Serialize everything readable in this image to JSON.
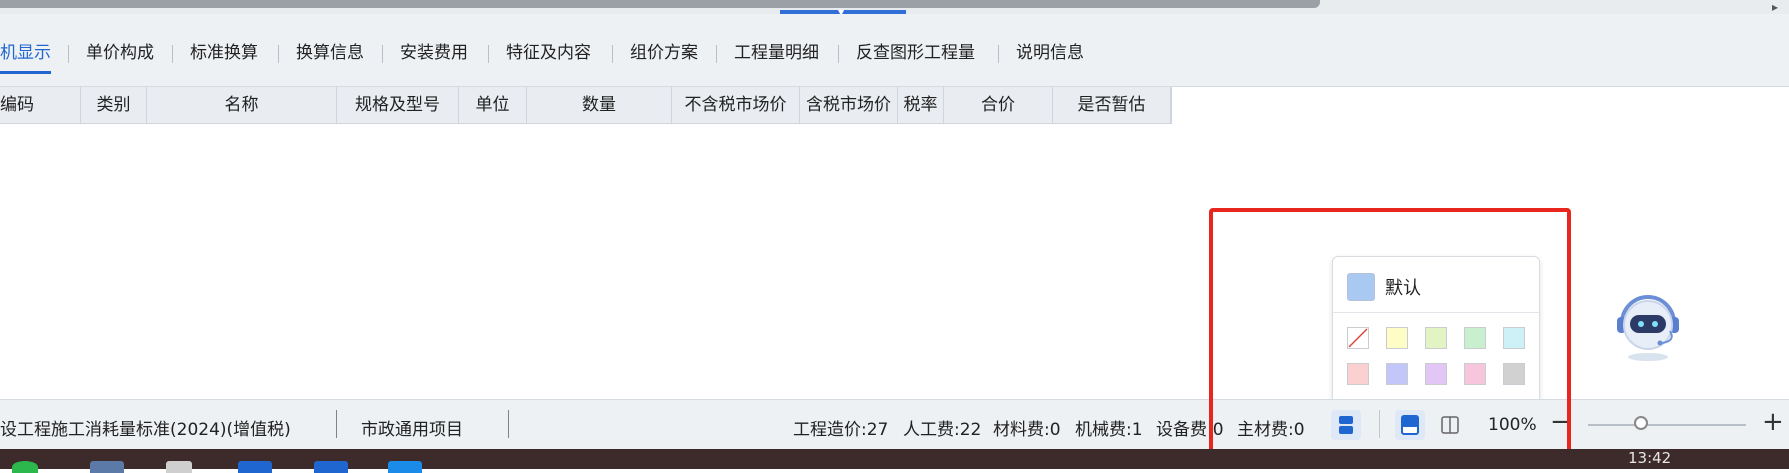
{
  "tabs": [
    {
      "label": "机显示",
      "active": true
    },
    {
      "label": "单价构成"
    },
    {
      "label": "标准换算"
    },
    {
      "label": "换算信息"
    },
    {
      "label": "安装费用"
    },
    {
      "label": "特征及内容"
    },
    {
      "label": "组价方案"
    },
    {
      "label": "工程量明细"
    },
    {
      "label": "反查图形工程量"
    },
    {
      "label": "说明信息"
    }
  ],
  "table": {
    "columns": [
      "编码",
      "类别",
      "名称",
      "规格及型号",
      "单位",
      "数量",
      "不含税市场价",
      "含税市场价",
      "税率",
      "合价",
      "是否暂估"
    ]
  },
  "color_popup": {
    "default_label": "默认",
    "default_color": "#a9c8f2",
    "swatches_row1": [
      "none",
      "#fdfdc5",
      "#e2f3c4",
      "#c8f0cf",
      "#cdf1f6"
    ],
    "swatches_row2": [
      "#fbd0d0",
      "#c2c6f8",
      "#e2c6f6",
      "#f8c6dc",
      "#d1d1d1"
    ]
  },
  "status": {
    "standard": "设工程施工消耗量标准(2024)(增值税)",
    "project_type": "市政通用项目",
    "cost_total": "工程造价:27",
    "labor": "人工费:22",
    "material": "材料费:0",
    "machine": "机械费:1",
    "equipment": "设备费:0",
    "main_material": "主材费:0",
    "zoom": "100%",
    "zoom_minus": "−",
    "zoom_plus": "+"
  },
  "taskbar": {
    "clock": "13:42"
  },
  "accent_color": "#1f66d1",
  "highlight_color": "#e8261d"
}
